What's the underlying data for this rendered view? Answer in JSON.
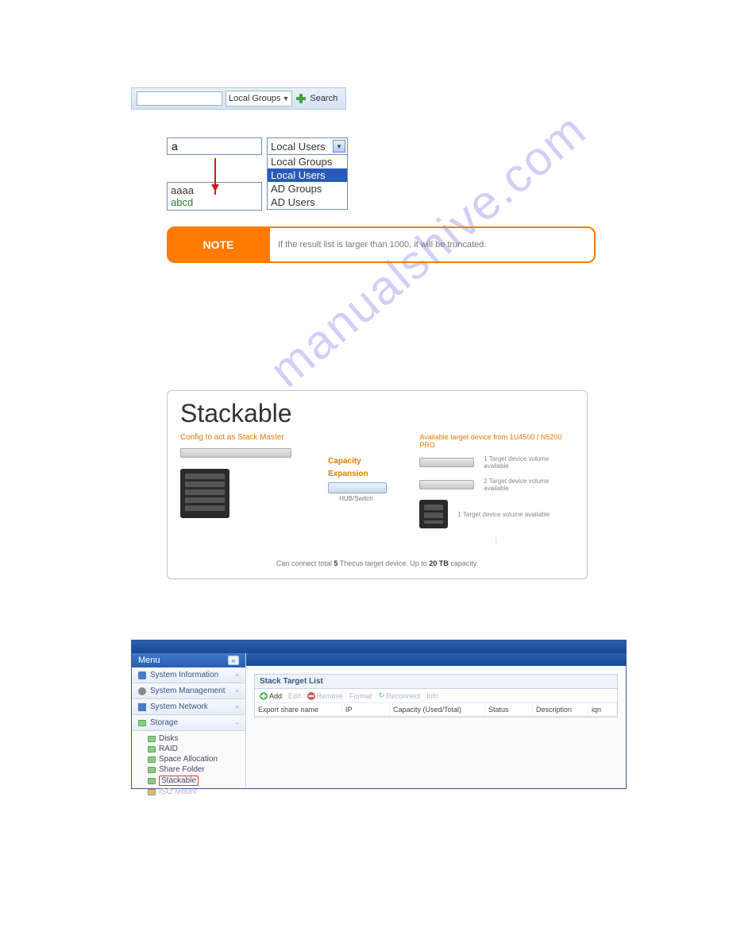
{
  "watermark": "manualshive.com",
  "searchbar": {
    "select_label": "Local Groups",
    "search_label": "Search"
  },
  "dropdown_demo": {
    "input_value": "a",
    "results": [
      "aaaa",
      "abcd"
    ],
    "selected": "Local Users",
    "options": [
      "Local Groups",
      "Local Users",
      "AD Groups",
      "AD Users"
    ]
  },
  "note": {
    "label": "NOTE",
    "text": "If the result list is larger than 1000, it will be truncated."
  },
  "stackable": {
    "title": "Stackable",
    "left_label": "Config to act as Stack Master",
    "capacity": "Capacity",
    "expansion": "Expansion",
    "hub": "HUB/Switch",
    "right_header": "Available target device from 1U4500 / N5200 PRO",
    "targets": [
      "1 Target device volume available",
      "2 Target device volume available",
      "1 Target device volume available"
    ],
    "footline_pre": "Can connect total ",
    "footline_n1": "5",
    "footline_mid": " Thecus target device.  Up to ",
    "footline_n2": "20 TB",
    "footline_post": " capacity."
  },
  "admin": {
    "menu_label": "Menu",
    "sections": {
      "sysinfo": "System Information",
      "sysmgmt": "System Management",
      "sysnet": "System Network",
      "storage": "Storage"
    },
    "tree": {
      "disks": "Disks",
      "raid": "RAID",
      "spacealloc": "Space Allocation",
      "sharefolder": "Share Folder",
      "stackable": "Stackable",
      "isomount": "ISO Mount"
    },
    "panel": {
      "title": "Stack Target List",
      "toolbar": {
        "add": "Add",
        "edit": "Edit",
        "remove": "Remove",
        "format": "Format",
        "reconnect": "Reconnect",
        "info": "Info"
      },
      "columns": {
        "export": "Export share name",
        "ip": "IP",
        "capacity": "Capacity (Used/Total)",
        "status": "Status",
        "description": "Description",
        "iqn": "iqn"
      }
    }
  }
}
